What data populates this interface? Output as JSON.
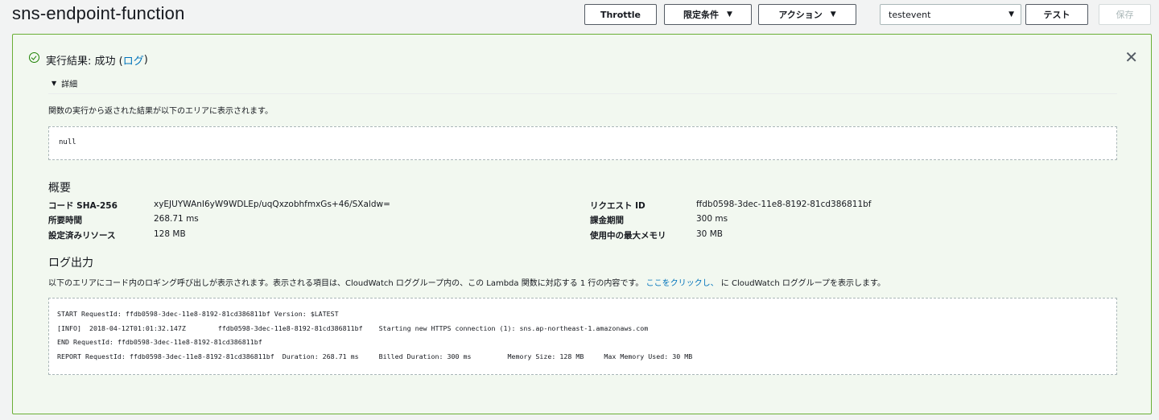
{
  "function_name": "sns-endpoint-function",
  "toolbar": {
    "throttle_label": "Throttle",
    "qualifier_label": "限定条件",
    "actions_label": "アクション",
    "test_event_selected": "testevent",
    "test_label": "テスト",
    "save_label": "保存"
  },
  "result": {
    "status_prefix": "実行結果: 成功 (",
    "log_link": "ログ",
    "status_suffix": ")",
    "details_label": "詳細",
    "description": "関数の実行から返された結果が以下のエリアに表示されます。",
    "output": "null"
  },
  "summary": {
    "title": "概要",
    "left": [
      {
        "key": "コード SHA-256",
        "value": "xyEJUYWAnI6yW9WDLEp/uqQxzobhfmxGs+46/SXaldw="
      },
      {
        "key": "所要時間",
        "value": "268.71 ms"
      },
      {
        "key": "設定済みリソース",
        "value": "128 MB"
      }
    ],
    "right": [
      {
        "key": "リクエスト ID",
        "value": "ffdb0598-3dec-11e8-8192-81cd386811bf"
      },
      {
        "key": "課金期間",
        "value": "300 ms"
      },
      {
        "key": "使用中の最大メモリ",
        "value": "30 MB"
      }
    ]
  },
  "log_output": {
    "title": "ログ出力",
    "description_before": "以下のエリアにコード内のロギング呼び出しが表示されます。表示される項目は、CloudWatch ロググループ内の、この Lambda 関数に対応する 1 行の内容です。",
    "click_link": "ここをクリックし、",
    "description_after": "に CloudWatch ロググループを表示します。",
    "lines": [
      "START RequestId: ffdb0598-3dec-11e8-8192-81cd386811bf Version: $LATEST",
      "[INFO]  2018-04-12T01:01:32.147Z        ffdb0598-3dec-11e8-8192-81cd386811bf    Starting new HTTPS connection (1): sns.ap-northeast-1.amazonaws.com",
      "END RequestId: ffdb0598-3dec-11e8-8192-81cd386811bf",
      "REPORT RequestId: ffdb0598-3dec-11e8-8192-81cd386811bf  Duration: 268.71 ms     Billed Duration: 300 ms         Memory Size: 128 MB     Max Memory Used: 30 MB"
    ]
  },
  "colors": {
    "success_green": "#1d8102",
    "panel_border": "#6aaf35",
    "link_blue": "#0073bb"
  }
}
